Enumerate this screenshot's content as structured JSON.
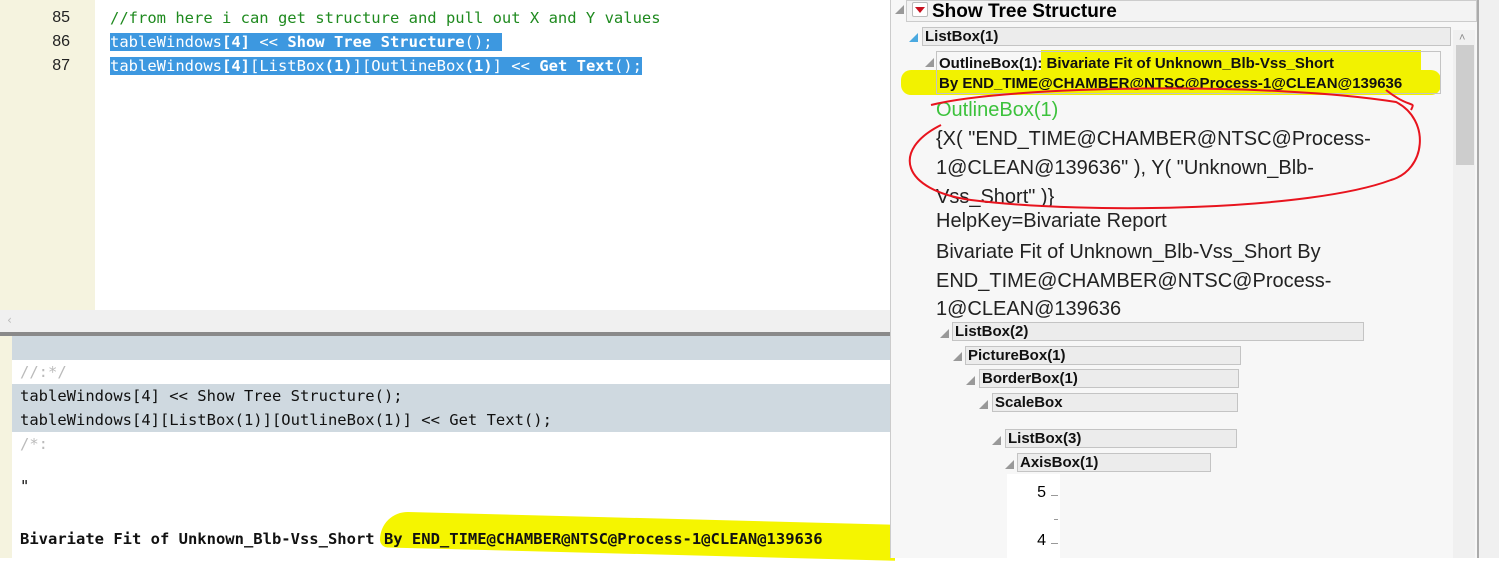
{
  "editor": {
    "lines": [
      {
        "num": "85",
        "text": "//from here i can get structure and pull out X and Y values"
      },
      {
        "num": "86",
        "parts": [
          "tableWindows",
          "[4]",
          " << ",
          "Show Tree Structure",
          "();"
        ]
      },
      {
        "num": "87",
        "parts": [
          "tableWindows",
          "[4]",
          "[ListBox",
          "(1)",
          "][OutlineBox",
          "(1)",
          "] << ",
          "Get Text",
          "();"
        ]
      }
    ],
    "scroll_left": "‹"
  },
  "log": {
    "lines": [
      "//:*/",
      "tableWindows[4] << Show Tree Structure();",
      "tableWindows[4][ListBox(1)][OutlineBox(1)] << Get Text();",
      "/*:",
      "\"",
      "Bivariate Fit of Unknown_Blb-Vss_Short By END_TIME@CHAMBER@NTSC@Process-1@CLEAN@139636"
    ]
  },
  "tree": {
    "title": "Show Tree Structure",
    "listbox1": "ListBox(1)",
    "outline1_line1": "OutlineBox(1): Bivariate Fit of Unknown_Blb-Vss_Short",
    "outline1_line2": "By END_TIME@CHAMBER@NTSC@Process-1@CLEAN@139636",
    "outline_label": "OutlineBox(1)",
    "xy_lines": [
      "{X( \"END_TIME@CHAMBER@NTSC@Process-",
      "1@CLEAN@139636\" ), Y( \"Unknown_Blb-",
      "Vss_Short\" )}"
    ],
    "helpkey": "HelpKey=Bivariate Report",
    "title_lines": [
      "Bivariate Fit of Unknown_Blb-Vss_Short By",
      "END_TIME@CHAMBER@NTSC@Process-",
      "1@CLEAN@139636"
    ],
    "nodes": [
      "ListBox(2)",
      "PictureBox(1)",
      "BorderBox(1)",
      "ScaleBox",
      "ListBox(3)",
      "AxisBox(1)"
    ],
    "axis_ticks": [
      "5",
      "4"
    ]
  },
  "colors": {
    "selection": "#3d98e0",
    "highlight": "#f2f200",
    "annotation": "#e8141e",
    "comment": "#1f8a1f",
    "outline_green": "#3cc23c"
  }
}
